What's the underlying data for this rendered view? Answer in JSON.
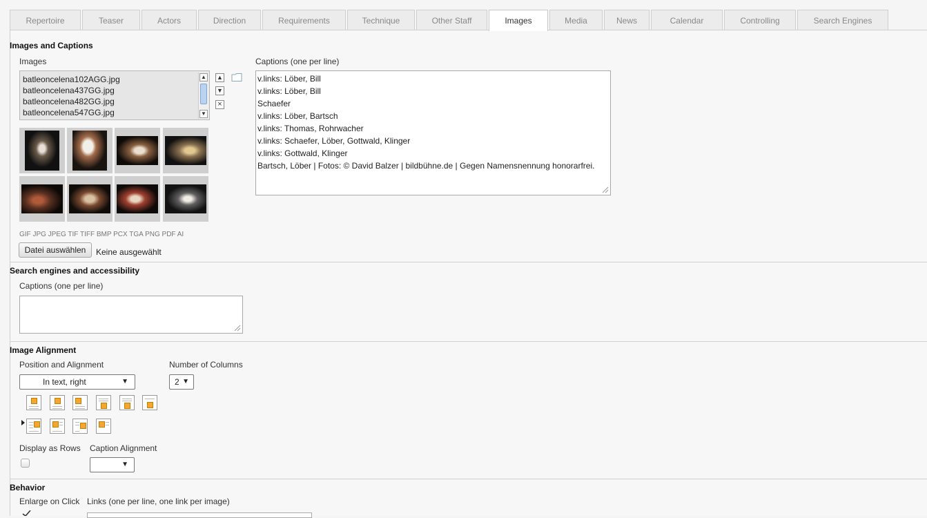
{
  "tabs": [
    {
      "label": "Repertoire"
    },
    {
      "label": "Teaser"
    },
    {
      "label": "Actors"
    },
    {
      "label": "Direction"
    },
    {
      "label": "Requirements"
    },
    {
      "label": "Technique"
    },
    {
      "label": "Other Staff"
    },
    {
      "label": "Images"
    },
    {
      "label": "Media"
    },
    {
      "label": "News"
    },
    {
      "label": "Calendar"
    },
    {
      "label": "Controlling"
    },
    {
      "label": "Search Engines"
    }
  ],
  "active_tab": "Images",
  "images_section": {
    "title": "Images and Captions",
    "images_label": "Images",
    "files": [
      "batleoncelena102AGG.jpg",
      "batleoncelena437GG.jpg",
      "batleoncelena482GG.jpg",
      "batleoncelena547GG.jpg"
    ],
    "captions_label": "Captions (one per line)",
    "captions": [
      "v.links: Löber, Bill",
      "v.links: Löber, Bill",
      "Schaefer",
      "v.links: Löber, Bartsch",
      "v.links: Thomas, Rohrwacher",
      "v.links: Schaefer, Löber, Gottwald, Klinger",
      "v.links: Gottwald, Klinger",
      "Bartsch, Löber | Fotos: © David Balzer | bildbühne.de | Gegen Namensnennung honorarfrei."
    ],
    "formats": "GIF JPG JPEG TIF TIFF BMP PCX TGA PNG PDF AI",
    "choose_file_label": "Datei auswählen",
    "no_file_label": "Keine ausgewählt"
  },
  "search_section": {
    "title": "Search engines and accessibility",
    "captions_label": "Captions (one per line)"
  },
  "alignment_section": {
    "title": "Image Alignment",
    "position_label": "Position and Alignment",
    "position_value": "In text, right",
    "columns_label": "Number of Columns",
    "columns_value": "2",
    "display_rows_label": "Display as Rows",
    "caption_alignment_label": "Caption Alignment"
  },
  "behavior_section": {
    "title": "Behavior",
    "enlarge_label": "Enlarge on Click",
    "links_label": "Links (one per line, one link per image)"
  },
  "colors": {
    "accent_orange": "#f0a830",
    "scroll_thumb": "#bcd3ef"
  }
}
